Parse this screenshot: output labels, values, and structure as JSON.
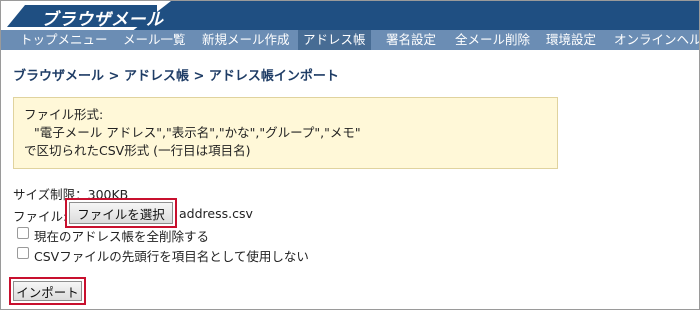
{
  "app": {
    "title": "ブラウザメール"
  },
  "nav": {
    "items": [
      {
        "label": "トップメニュー"
      },
      {
        "label": "メール一覧"
      },
      {
        "label": "新規メール作成"
      },
      {
        "label": "アドレス帳",
        "active": true
      },
      {
        "label": "署名設定"
      },
      {
        "label": "全メール削除"
      },
      {
        "label": "環境設定"
      },
      {
        "label": "オンラインヘルプ"
      }
    ]
  },
  "breadcrumb": "ブラウザメール > アドレス帳 > アドレス帳インポート",
  "info": {
    "line1": "ファイル形式:",
    "line2": "\"電子メール アドレス\",\"表示名\",\"かな\",\"グループ\",\"メモ\"",
    "line3": "で区切られたCSV形式 (一行目は項目名)"
  },
  "form": {
    "size_limit": "サイズ制限：300KB",
    "file_label": "ファイル:",
    "file_button": "ファイルを選択",
    "file_name": "address.csv",
    "delete_all_label": "現在のアドレス帳を全削除する",
    "skip_header_label": "CSVファイルの先頭行を項目名として使用しない",
    "import_button": "インポート"
  },
  "colors": {
    "header_bg": "#1f4f82",
    "nav_bg": "#6b8db4",
    "nav_active": "#476c94",
    "info_bg": "#fff8d8",
    "highlight": "#c8102e"
  }
}
